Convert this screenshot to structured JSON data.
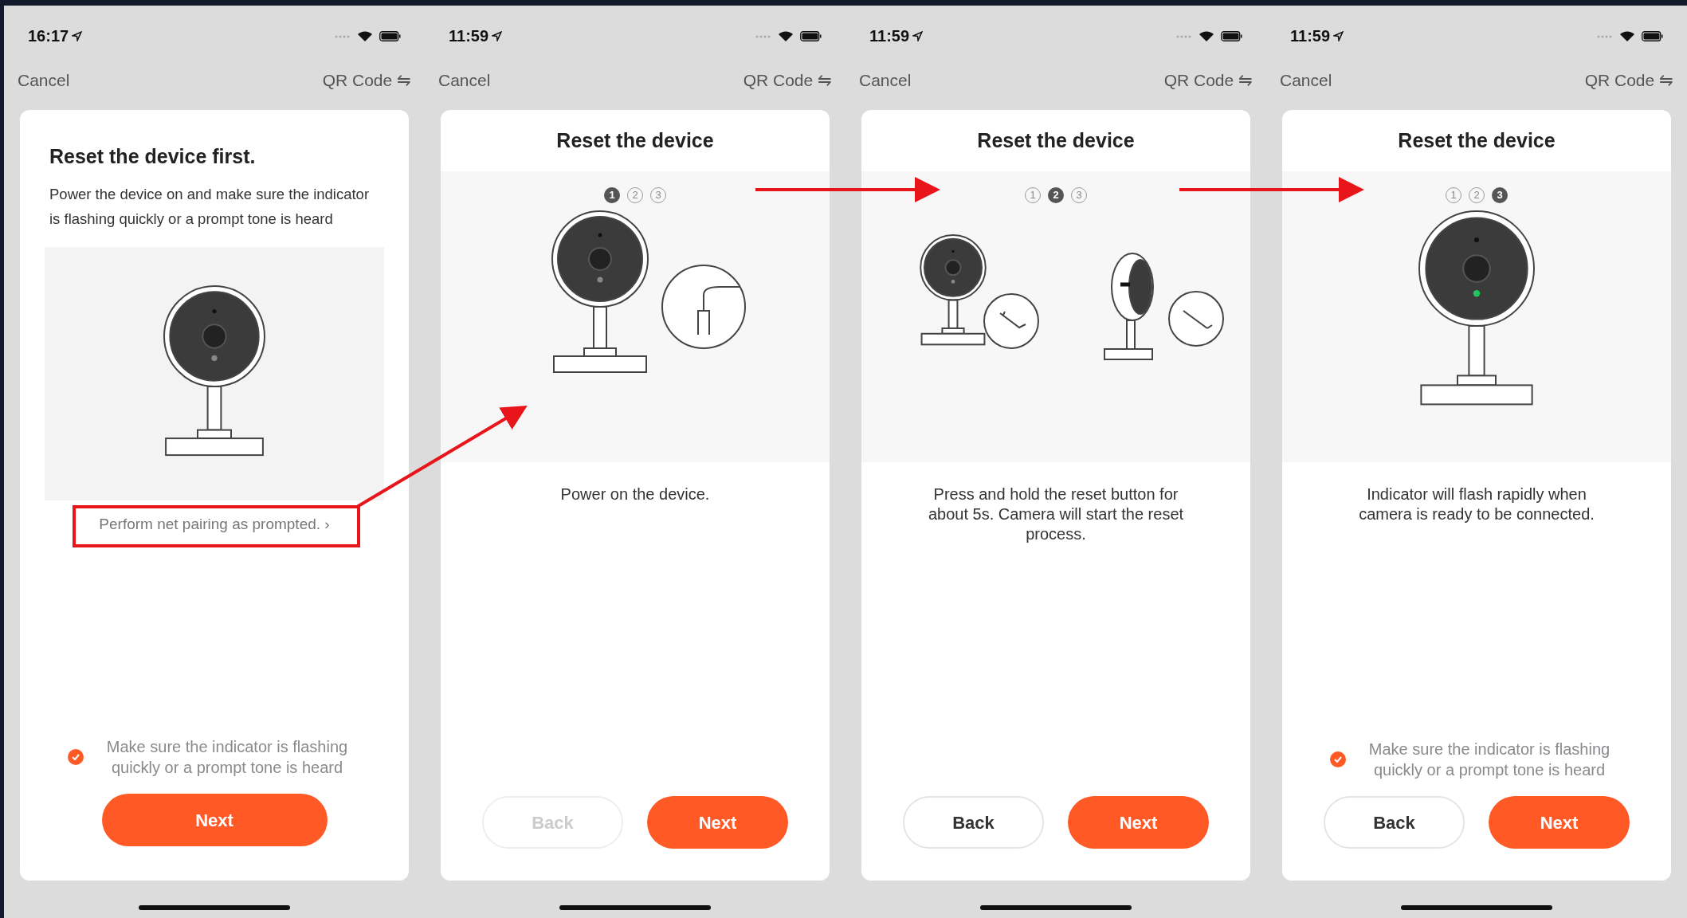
{
  "screens": [
    {
      "kind": "intro",
      "time": "16:17",
      "cancel": "Cancel",
      "qr_code": "QR Code ⇋",
      "title": "Reset the device first.",
      "description": "Power the device on and make sure the indicator is flashing quickly or a prompt tone is heard",
      "link": "Perform net pairing as prompted. ›",
      "checkbox": {
        "label": "Make sure the indicator is flashing quickly or a prompt tone is heard",
        "checked": true
      },
      "next": "Next"
    },
    {
      "kind": "step",
      "time": "11:59",
      "cancel": "Cancel",
      "qr_code": "QR Code ⇋",
      "title": "Reset the device",
      "steps": [
        {
          "label": "1",
          "selected": true
        },
        {
          "label": "2",
          "selected": false
        },
        {
          "label": "3",
          "selected": false
        }
      ],
      "description": "Power on the device.",
      "back": {
        "label": "Back",
        "disabled": true
      },
      "next": "Next"
    },
    {
      "kind": "step",
      "time": "11:59",
      "cancel": "Cancel",
      "qr_code": "QR Code ⇋",
      "title": "Reset the device",
      "steps": [
        {
          "label": "1",
          "selected": false
        },
        {
          "label": "2",
          "selected": true
        },
        {
          "label": "3",
          "selected": false
        }
      ],
      "description": "Press and hold the reset button for about 5s. Camera will start the reset process.",
      "back": {
        "label": "Back",
        "disabled": false
      },
      "next": "Next"
    },
    {
      "kind": "step",
      "time": "11:59",
      "cancel": "Cancel",
      "qr_code": "QR Code ⇋",
      "title": "Reset the device",
      "steps": [
        {
          "label": "1",
          "selected": false
        },
        {
          "label": "2",
          "selected": false
        },
        {
          "label": "3",
          "selected": true
        }
      ],
      "description": "Indicator will flash rapidly when camera is ready to be connected.",
      "checkbox": {
        "label": "Make sure the indicator is flashing quickly or a prompt tone is heard",
        "checked": true
      },
      "back": {
        "label": "Back",
        "disabled": false
      },
      "next": "Next"
    }
  ]
}
